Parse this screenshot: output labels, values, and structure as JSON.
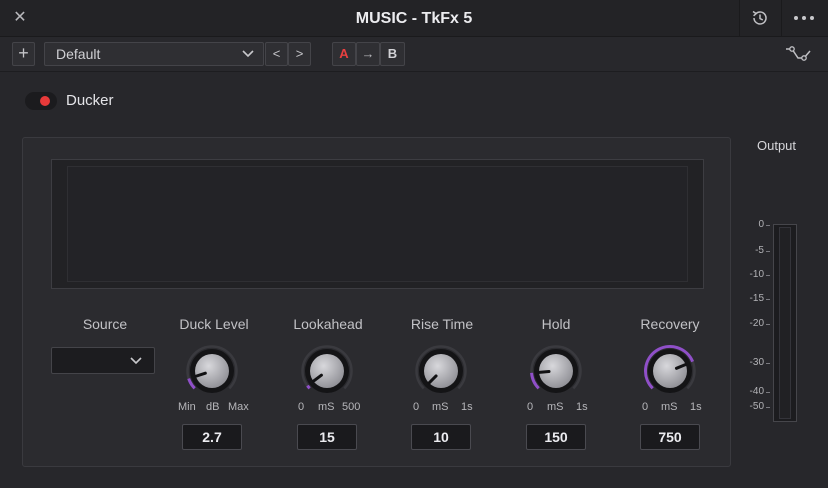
{
  "window": {
    "title": "MUSIC - TkFx 5",
    "close_icon": "close-icon",
    "history_icon": "history-icon",
    "more_icon": "more-icon"
  },
  "toolbar": {
    "add_label": "+",
    "preset": "Default",
    "prev_label": "<",
    "next_label": ">",
    "ab_a": "A",
    "ab_copy": "→",
    "ab_b": "B",
    "waveform_icon": "waveform-icon"
  },
  "ducker": {
    "label": "Ducker",
    "enabled": true
  },
  "source": {
    "label": "Source",
    "value": ""
  },
  "controls": [
    {
      "label": "Duck Level",
      "scale_min": "Min",
      "unit": "dB",
      "scale_max": "Max",
      "value": "2.7",
      "level": 0.1
    },
    {
      "label": "Lookahead",
      "scale_min": "0",
      "unit": "mS",
      "scale_max": "500",
      "value": "15",
      "level": 0.03
    },
    {
      "label": "Rise Time",
      "scale_min": "0",
      "unit": "mS",
      "scale_max": "1s",
      "value": "10",
      "level": 0.0
    },
    {
      "label": "Hold",
      "scale_min": "0",
      "unit": "mS",
      "scale_max": "1s",
      "value": "150",
      "level": 0.15
    },
    {
      "label": "Recovery",
      "scale_min": "0",
      "unit": "mS",
      "scale_max": "1s",
      "value": "750",
      "level": 0.75
    }
  ],
  "output": {
    "label": "Output",
    "ticks": [
      "0",
      "-5",
      "-10",
      "-15",
      "-20",
      "-30",
      "-40",
      "-50"
    ]
  },
  "colors": {
    "accent_red": "#e83a3a",
    "arc_purple": "#8f4fc8"
  }
}
